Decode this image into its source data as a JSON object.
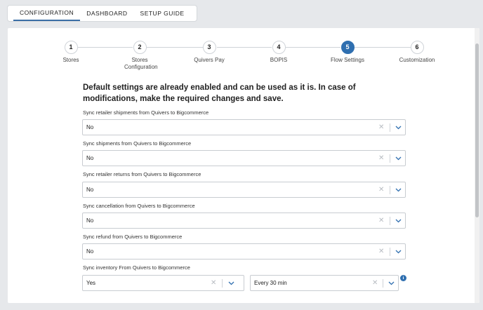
{
  "tabs": [
    {
      "label": "CONFIGURATION"
    },
    {
      "label": "DASHBOARD"
    },
    {
      "label": "SETUP GUIDE"
    }
  ],
  "steps": [
    {
      "number": "1",
      "label": "Stores"
    },
    {
      "number": "2",
      "label": "Stores Configuration"
    },
    {
      "number": "3",
      "label": "Quivers Pay"
    },
    {
      "number": "4",
      "label": "BOPIS"
    },
    {
      "number": "5",
      "label": "Flow Settings",
      "active": true
    },
    {
      "number": "6",
      "label": "Customization"
    }
  ],
  "intro": "Default settings are already enabled and can be used as it is. In case of modifications, make the required changes and save.",
  "fields": [
    {
      "label": "Sync retailer shipments from Quivers to Bigcommerce",
      "value": "No"
    },
    {
      "label": "Sync shipments from Quivers to Bigcommerce",
      "value": "No"
    },
    {
      "label": "Sync retailer returns from Quivers to Bigcommerce",
      "value": "No"
    },
    {
      "label": "Sync cancellation from Quivers to Bigcommerce",
      "value": "No"
    },
    {
      "label": "Sync refund from Quivers to Bigcommerce",
      "value": "No"
    },
    {
      "label": "Sync inventory From Quivers to Bigcommerce",
      "value": "Yes",
      "frequency": "Every 30 min"
    }
  ],
  "icons": {
    "clear": "✕",
    "chevron": "chevron-down-icon",
    "info": "i"
  },
  "stray_text": ";",
  "colors": {
    "accent": "#2f6fb0"
  }
}
